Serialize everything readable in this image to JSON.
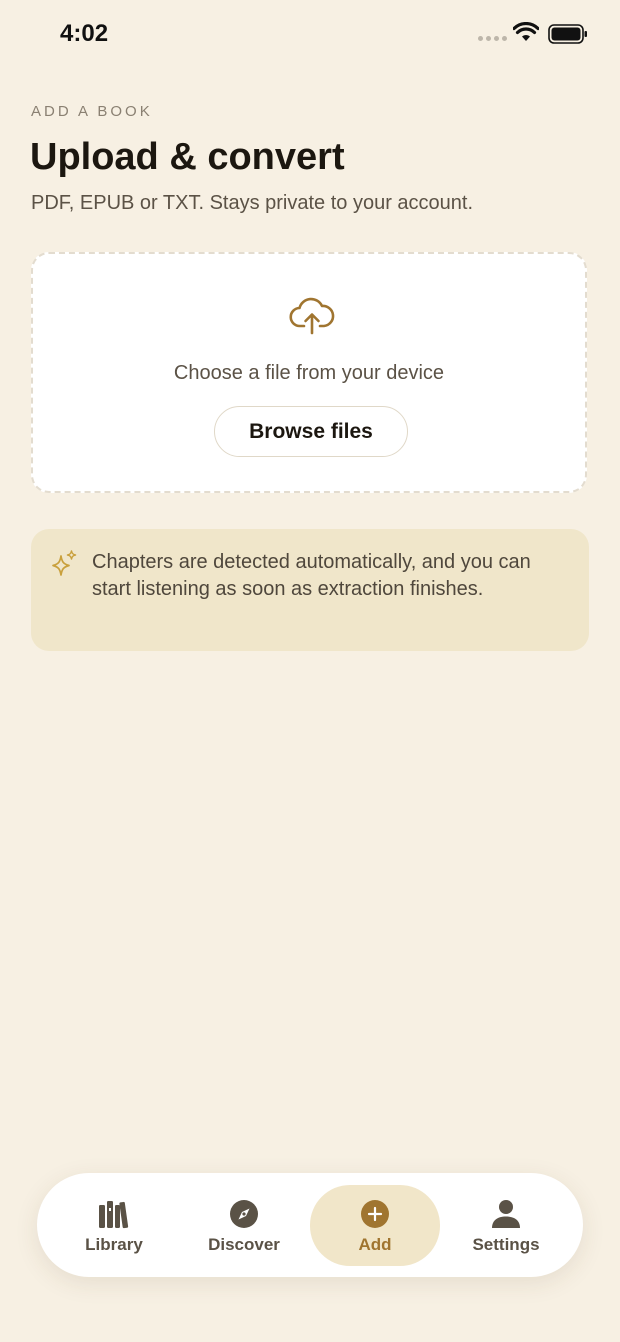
{
  "status_bar": {
    "time": "4:02"
  },
  "header": {
    "eyebrow": "ADD A BOOK",
    "title": "Upload & convert",
    "subtitle": "PDF, EPUB or TXT. Stays private to your account."
  },
  "upload": {
    "icon": "cloud-upload-icon",
    "prompt": "Choose a file from your device",
    "browse_label": "Browse files"
  },
  "info": {
    "icon": "sparkle-icon",
    "text": "Chapters are detected automatically, and you can start listening as soon as extraction finishes."
  },
  "tabs": [
    {
      "label": "Library",
      "icon": "library-icon",
      "active": false
    },
    {
      "label": "Discover",
      "icon": "compass-icon",
      "active": false
    },
    {
      "label": "Add",
      "icon": "plus-circle-icon",
      "active": true
    },
    {
      "label": "Settings",
      "icon": "person-icon",
      "active": false
    }
  ],
  "colors": {
    "background": "#f7f0e3",
    "accent": "#a07530",
    "banner": "#f0e6ca",
    "active_tab": "#f1e6c9"
  }
}
